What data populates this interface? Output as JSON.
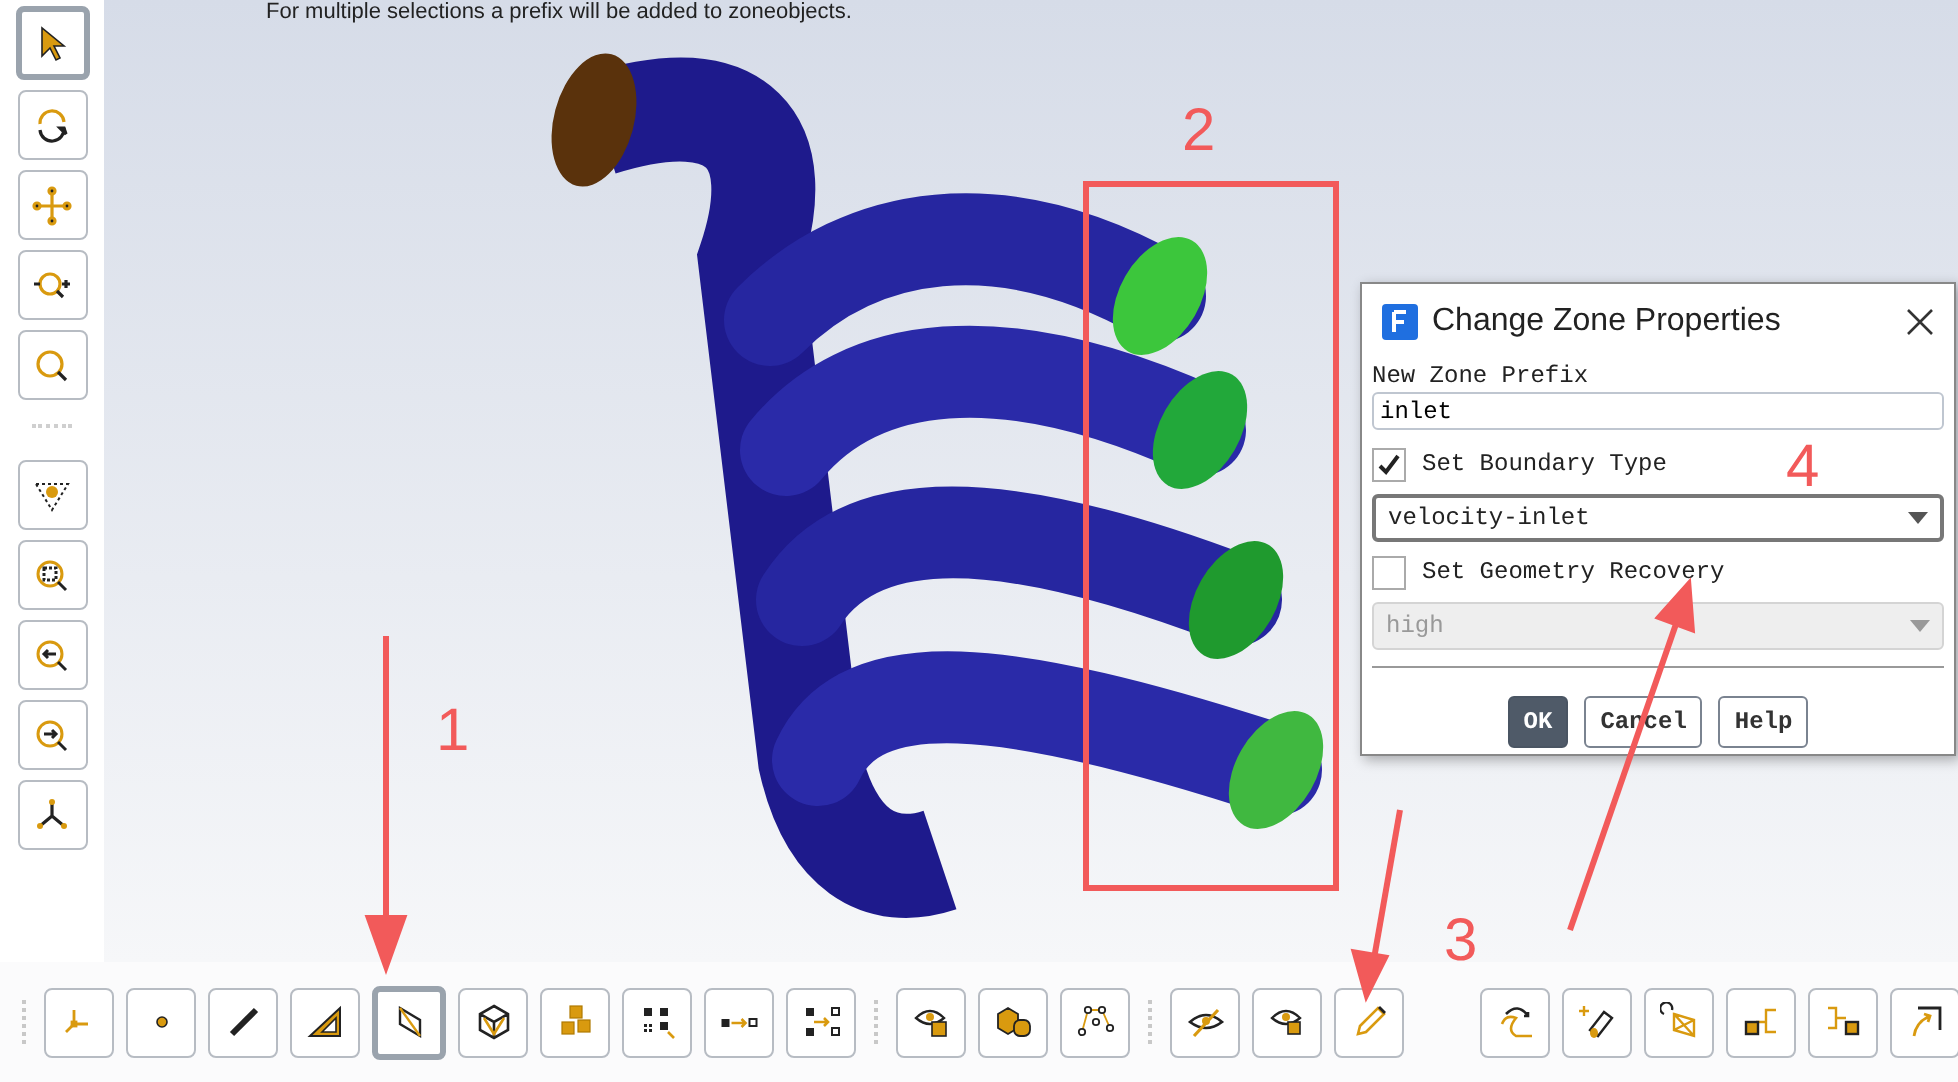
{
  "viewport": {
    "caption": "For multiple selections a prefix will be added to zoneobjects."
  },
  "left_toolbar": {
    "groups": [
      {
        "buttons": [
          {
            "selected": true
          },
          {
            "selected": false
          },
          {
            "selected": false
          },
          {
            "selected": false
          },
          {
            "selected": false
          }
        ]
      },
      {
        "buttons": [
          {
            "selected": false
          },
          {
            "selected": false
          },
          {
            "selected": false
          },
          {
            "selected": false
          },
          {
            "selected": false
          }
        ]
      }
    ]
  },
  "bottom_toolbar": {
    "groups": [
      {
        "buttons": [
          {
            "selected": false
          },
          {
            "selected": false
          },
          {
            "selected": false
          },
          {
            "selected": false
          },
          {
            "selected": true
          },
          {
            "selected": false
          },
          {
            "selected": false
          },
          {
            "selected": false
          },
          {
            "selected": false
          },
          {
            "selected": false
          }
        ]
      },
      {
        "buttons": [
          {
            "selected": false
          },
          {
            "selected": false
          },
          {
            "selected": false
          }
        ]
      },
      {
        "buttons": [
          {
            "selected": false
          },
          {
            "selected": false
          },
          {
            "selected": false
          }
        ]
      },
      {
        "buttons": [
          {
            "selected": false
          },
          {
            "selected": false
          },
          {
            "selected": false
          },
          {
            "selected": false
          },
          {
            "selected": false
          },
          {
            "selected": false
          }
        ]
      }
    ]
  },
  "annotations": [
    "1",
    "2",
    "3",
    "4"
  ],
  "dialog": {
    "title": "Change Zone Properties",
    "prefix_label": "New Zone Prefix",
    "prefix_value": "inlet",
    "boundary": {
      "label": "Set Boundary Type",
      "checked": true,
      "value": "velocity-inlet",
      "disabled": false
    },
    "recovery": {
      "label": "Set Geometry Recovery",
      "checked": false,
      "value": "high",
      "disabled": true
    },
    "buttons": [
      {
        "label": "OK",
        "primary": true
      },
      {
        "label": "Cancel",
        "primary": false
      },
      {
        "label": "Help",
        "primary": false
      }
    ]
  }
}
